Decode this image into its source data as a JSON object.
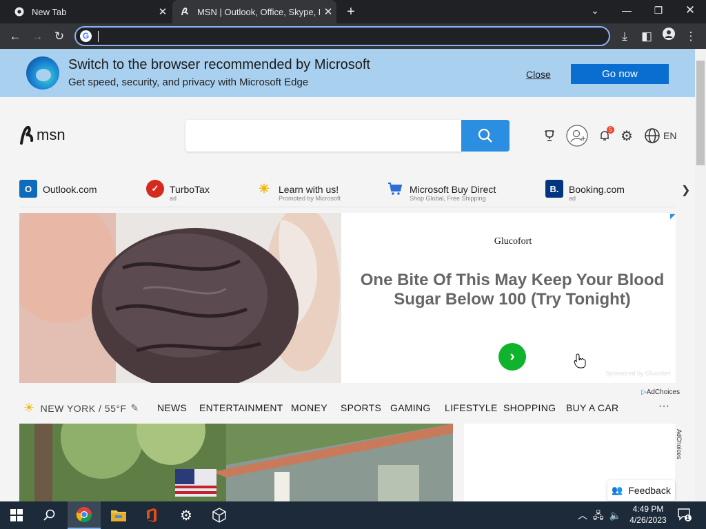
{
  "browser": {
    "tabs": [
      {
        "title": "New Tab",
        "icon": "chrome-icon",
        "active": false
      },
      {
        "title": "MSN | Outlook, Office, Skype, Bing, Breaking News, and Latest Videos",
        "icon": "msn-icon",
        "active": true
      }
    ],
    "address_value": "",
    "accent_color": "#8ab4f8"
  },
  "edge_banner": {
    "title": "Switch to the browser recommended by Microsoft",
    "subtitle": "Get speed, security, and privacy with Microsoft Edge",
    "close_label": "Close",
    "go_label": "Go now",
    "button_color": "#0a6ed1"
  },
  "header": {
    "logo_text": "msn",
    "search_value": "",
    "notification_count": "5",
    "language": "EN"
  },
  "quick_links": [
    {
      "title": "Outlook.com",
      "sub": "",
      "color": "#0f6cbd",
      "glyph": "O"
    },
    {
      "title": "TurboTax",
      "sub": "ad",
      "color": "#d52b1e",
      "glyph": "✓"
    },
    {
      "title": "Learn with us!",
      "sub": "Promoted by Microsoft",
      "color": "#f4b400",
      "glyph": "💡"
    },
    {
      "title": "Microsoft Buy Direct",
      "sub": "Shop Global, Free Shipping",
      "color": "#2b6fd6",
      "glyph": "🛒"
    },
    {
      "title": "Booking.com",
      "sub": "ad",
      "color": "#003580",
      "glyph": "B."
    }
  ],
  "ad": {
    "brand": "Glucofort",
    "headline": "One Bite Of This May Keep Your Blood Sugar Below 100 (Try Tonight)",
    "sponsored": "Sponsored by Glucofort",
    "adchoices": "AdChoices"
  },
  "categories": {
    "weather": "NEW YORK / 55°F",
    "items": [
      "NEWS",
      "ENTERTAINMENT",
      "MONEY",
      "SPORTS",
      "GAMING",
      "LIFESTYLE",
      "SHOPPING",
      "BUY A CAR"
    ],
    "more": "···"
  },
  "side": {
    "adchoices": "AdChoices",
    "feedback": "Feedback"
  },
  "taskbar": {
    "time": "4:49 PM",
    "date": "4/26/2023",
    "notification_count": "1"
  }
}
